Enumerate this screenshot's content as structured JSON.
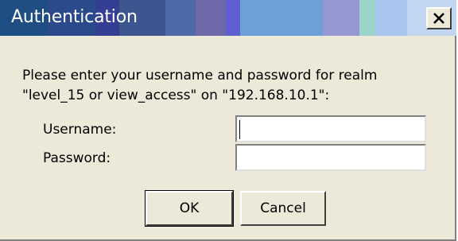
{
  "dialog": {
    "title": "Authentication",
    "message_line1": "Please enter your username and password for realm",
    "message_line2": "\"level_15 or view_access\" on \"192.168.10.1\":",
    "fields": {
      "username_label": "Username:",
      "username_value": "",
      "password_label": "Password:",
      "password_value": ""
    },
    "buttons": {
      "ok_label": "OK",
      "cancel_label": "Cancel"
    },
    "close_icon": "close-icon"
  },
  "colors": {
    "dialog_background": "#ece9d8",
    "title_text": "#ffffff",
    "titlebar_bands": [
      "#1f4e85",
      "#2a4a8c",
      "#3e4f9e",
      "#5a59ad",
      "#6f6bb8",
      "#5e5fd1",
      "#6a9ad8",
      "#74a4dc",
      "#8e98d6",
      "#9ba6d8",
      "#9ad6d0",
      "#a6c4ef",
      "#b8d0f2",
      "#c6d8f2"
    ]
  }
}
